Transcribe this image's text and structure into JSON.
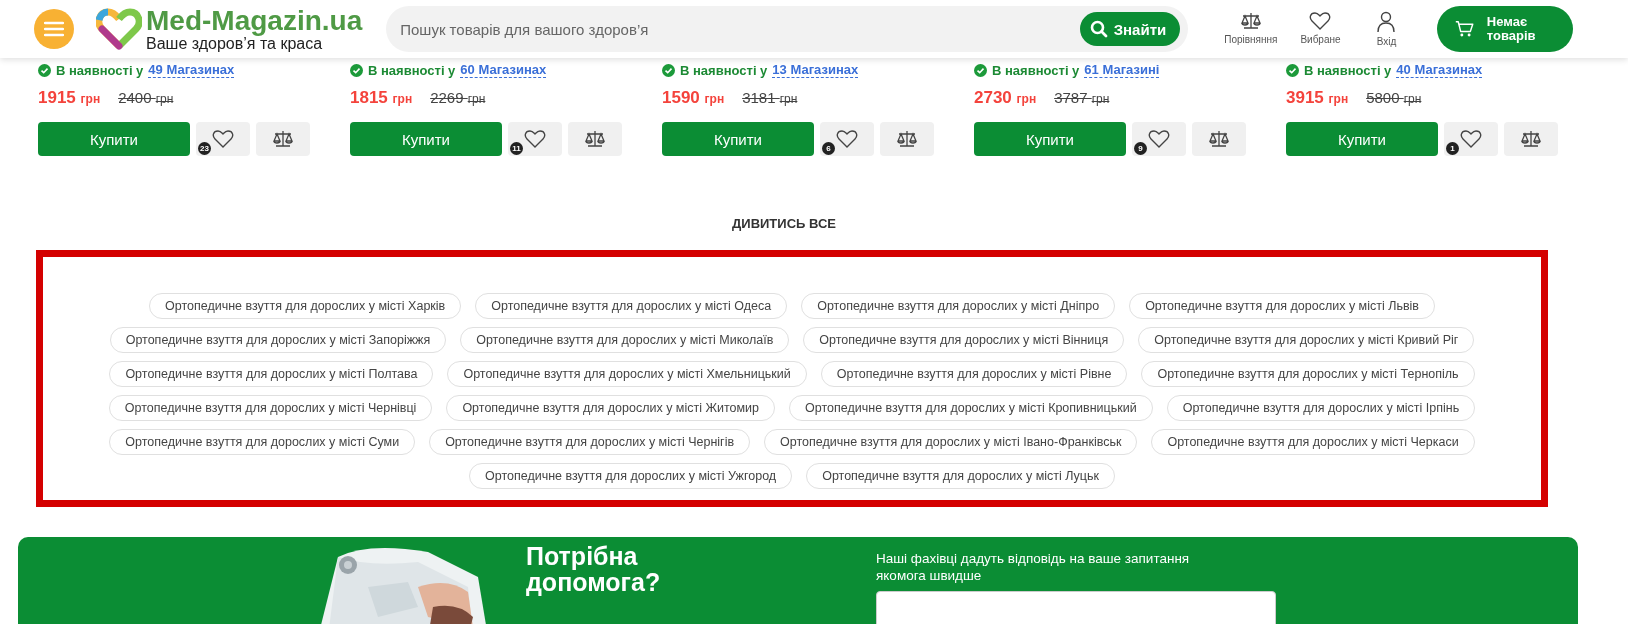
{
  "header": {
    "logo_title": "Med-Magazin.ua",
    "logo_tagline": "Ваше здоров’я та краса",
    "search": {
      "placeholder": "Пошук товарів для вашого здоров’я",
      "button": "Знайти"
    },
    "actions": [
      {
        "kind": "compare",
        "label": "Порівняння"
      },
      {
        "kind": "favorites",
        "label": "Вибране"
      },
      {
        "kind": "login",
        "label": "Вхід"
      }
    ],
    "cart": "Немає товарів"
  },
  "products": [
    {
      "availability": "В наявності у",
      "stores": "49 Магазинах",
      "price": "1915",
      "currency": "грн",
      "old_price": "2400",
      "old_currency": "грн",
      "buy": "Купити",
      "favorites_count": "23"
    },
    {
      "availability": "В наявності у",
      "stores": "60 Магазинах",
      "price": "1815",
      "currency": "грн",
      "old_price": "2269",
      "old_currency": "грн",
      "buy": "Купити",
      "favorites_count": "11"
    },
    {
      "availability": "В наявності у",
      "stores": "13 Магазинах",
      "price": "1590",
      "currency": "грн",
      "old_price": "3181",
      "old_currency": "грн",
      "buy": "Купити",
      "favorites_count": "6"
    },
    {
      "availability": "В наявності у",
      "stores": "61 Магазині",
      "price": "2730",
      "currency": "грн",
      "old_price": "3787",
      "old_currency": "грн",
      "buy": "Купити",
      "favorites_count": "9"
    },
    {
      "availability": "В наявності у",
      "stores": "40 Магазинах",
      "price": "3915",
      "currency": "грн",
      "old_price": "5800",
      "old_currency": "грн",
      "buy": "Купити",
      "favorites_count": "1"
    }
  ],
  "view_all": "ДИВИТИСЬ ВСЕ",
  "city_tags": [
    "Ортопедичне взуття для дорослих у місті Харків",
    "Ортопедичне взуття для дорослих у місті Одеса",
    "Ортопедичне взуття для дорослих у місті Дніпро",
    "Ортопедичне взуття для дорослих у місті Львів",
    "Ортопедичне взуття для дорослих у місті Запоріжжя",
    "Ортопедичне взуття для дорослих у місті Миколаїв",
    "Ортопедичне взуття для дорослих у місті Вінниця",
    "Ортопедичне взуття для дорослих у місті Кривий Ріг",
    "Ортопедичне взуття для дорослих у місті Полтава",
    "Ортопедичне взуття для дорослих у місті Хмельницький",
    "Ортопедичне взуття для дорослих у місті Рівне",
    "Ортопедичне взуття для дорослих у місті Тернопіль",
    "Ортопедичне взуття для дорослих у місті Чернівці",
    "Ортопедичне взуття для дорослих у місті Житомир",
    "Ортопедичне взуття для дорослих у місті Кропивницький",
    "Ортопедичне взуття для дорослих у місті Ірпінь",
    "Ортопедичне взуття для дорослих у місті Суми",
    "Ортопедичне взуття для дорослих у місті Чернігів",
    "Ортопедичне взуття для дорослих у місті Івано-Франківськ",
    "Ортопедичне взуття для дорослих у місті Черкаси",
    "Ортопедичне взуття для дорослих у місті Ужгород",
    "Ортопедичне взуття для дорослих у місті Луцьк"
  ],
  "help": {
    "title": "Потрібна допомога?",
    "text": "Наші фахівці дадуть відповідь на ваше запитання якомога швидше"
  }
}
